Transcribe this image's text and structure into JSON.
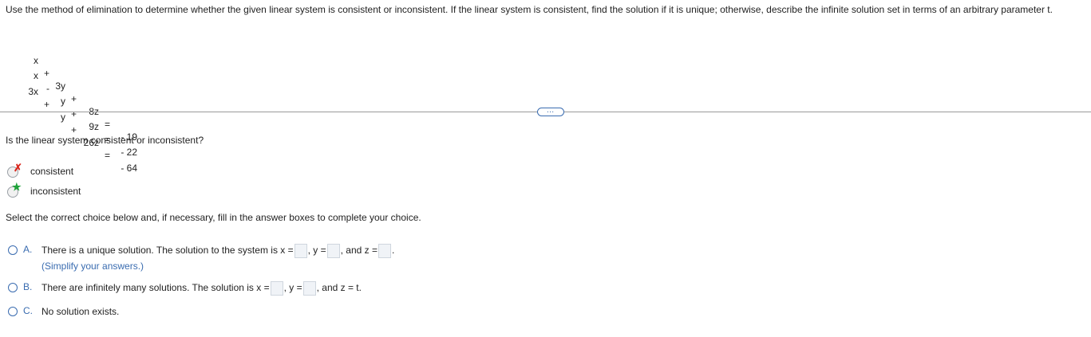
{
  "instructions": "Use the method of elimination to determine whether the given linear system is consistent or inconsistent. If the linear system is consistent, find the solution if it is unique; otherwise, describe the infinite solution set in terms of an arbitrary parameter t.",
  "system": [
    {
      "c1": "x",
      "op1": "+",
      "c2": "3y",
      "op2": "+",
      "c3": "8z",
      "eq": "=",
      "rhs": "- 19"
    },
    {
      "c1": "x",
      "op1": "-",
      "c2": "y",
      "op2": "+",
      "c3": "9z",
      "eq": "=",
      "rhs": "- 22"
    },
    {
      "c1": "3x",
      "op1": "+",
      "c2": "y",
      "op2": "+",
      "c3": "26z",
      "eq": "=",
      "rhs": "- 64"
    }
  ],
  "more_button": "…",
  "question": "Is the linear system consistent or inconsistent?",
  "options": [
    {
      "label": "consistent",
      "mark": "✗",
      "mark_color": "#d9261c"
    },
    {
      "label": "inconsistent",
      "mark": "★",
      "mark_color": "#1fa33a"
    }
  ],
  "choice_instruction": "Select the correct choice below and, if necessary, fill in the answer boxes to complete your choice.",
  "choices": {
    "a": {
      "letter": "A.",
      "text1": "There is a unique solution. The solution to the system is x =",
      "text2": ", y =",
      "text3": ", and z =",
      "text4": ".",
      "hint": "(Simplify your answers.)"
    },
    "b": {
      "letter": "B.",
      "text1": "There are infinitely many solutions. The solution is x =",
      "text2": ", y =",
      "text3": ", and z = t."
    },
    "c": {
      "letter": "C.",
      "text1": "No solution exists."
    }
  },
  "colors": {
    "accent": "#3a6cb0",
    "wrong": "#d9261c",
    "correct": "#1fa33a"
  }
}
